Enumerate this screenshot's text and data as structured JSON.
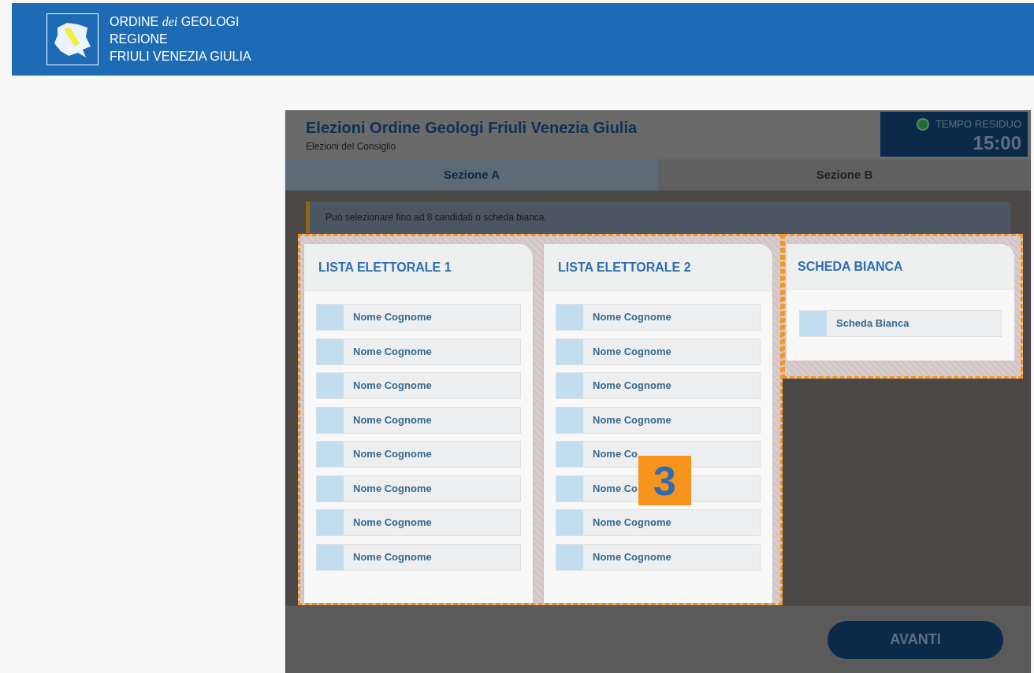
{
  "brand": {
    "lines": [
      "ORDINE",
      "dei",
      "GEOLOGI",
      "REGIONE",
      "FRIULI VENEZIA GIULIA"
    ]
  },
  "election": {
    "title": "Elezioni Ordine Geologi Friuli Venezia Giulia",
    "subtitle": "Elezioni del Consiglio"
  },
  "timer": {
    "label": "TEMPO RESIDUO",
    "value": "15:00"
  },
  "tabs": [
    {
      "label": "Sezione A",
      "selected": true
    },
    {
      "label": "Sezione B",
      "selected": false
    }
  ],
  "notice": "Può selezionare fino ad 8 candidati o scheda bianca.",
  "lists": [
    {
      "title": "LISTA ELETTORALE 1",
      "candidates": [
        {
          "name": "Nome Cognome",
          "selected": false
        },
        {
          "name": "Nome Cognome",
          "selected": false
        },
        {
          "name": "Nome Cognome",
          "selected": false
        },
        {
          "name": "Nome Cognome",
          "selected": false
        },
        {
          "name": "Nome Cognome",
          "selected": false
        },
        {
          "name": "Nome Cognome",
          "selected": false
        },
        {
          "name": "Nome Cognome",
          "selected": false
        },
        {
          "name": "Nome Cognome",
          "selected": false
        }
      ]
    },
    {
      "title": "LISTA ELETTORALE 2",
      "candidates": [
        {
          "name": "Nome Cognome",
          "selected": false
        },
        {
          "name": "Nome Cognome",
          "selected": false
        },
        {
          "name": "Nome Cognome",
          "selected": false
        },
        {
          "name": "Nome Cognome",
          "selected": false
        },
        {
          "name": "Nome Co",
          "selected": false
        },
        {
          "name": "Nome Co",
          "selected": false
        },
        {
          "name": "Nome Cognome",
          "selected": false
        },
        {
          "name": "Nome Cognome",
          "selected": false
        }
      ]
    }
  ],
  "blank_ballot": {
    "title": "SCHEDA BIANCA",
    "option": {
      "name": "Scheda Bianca",
      "selected": false
    }
  },
  "step_badge": "3",
  "next_button": "AVANTI"
}
